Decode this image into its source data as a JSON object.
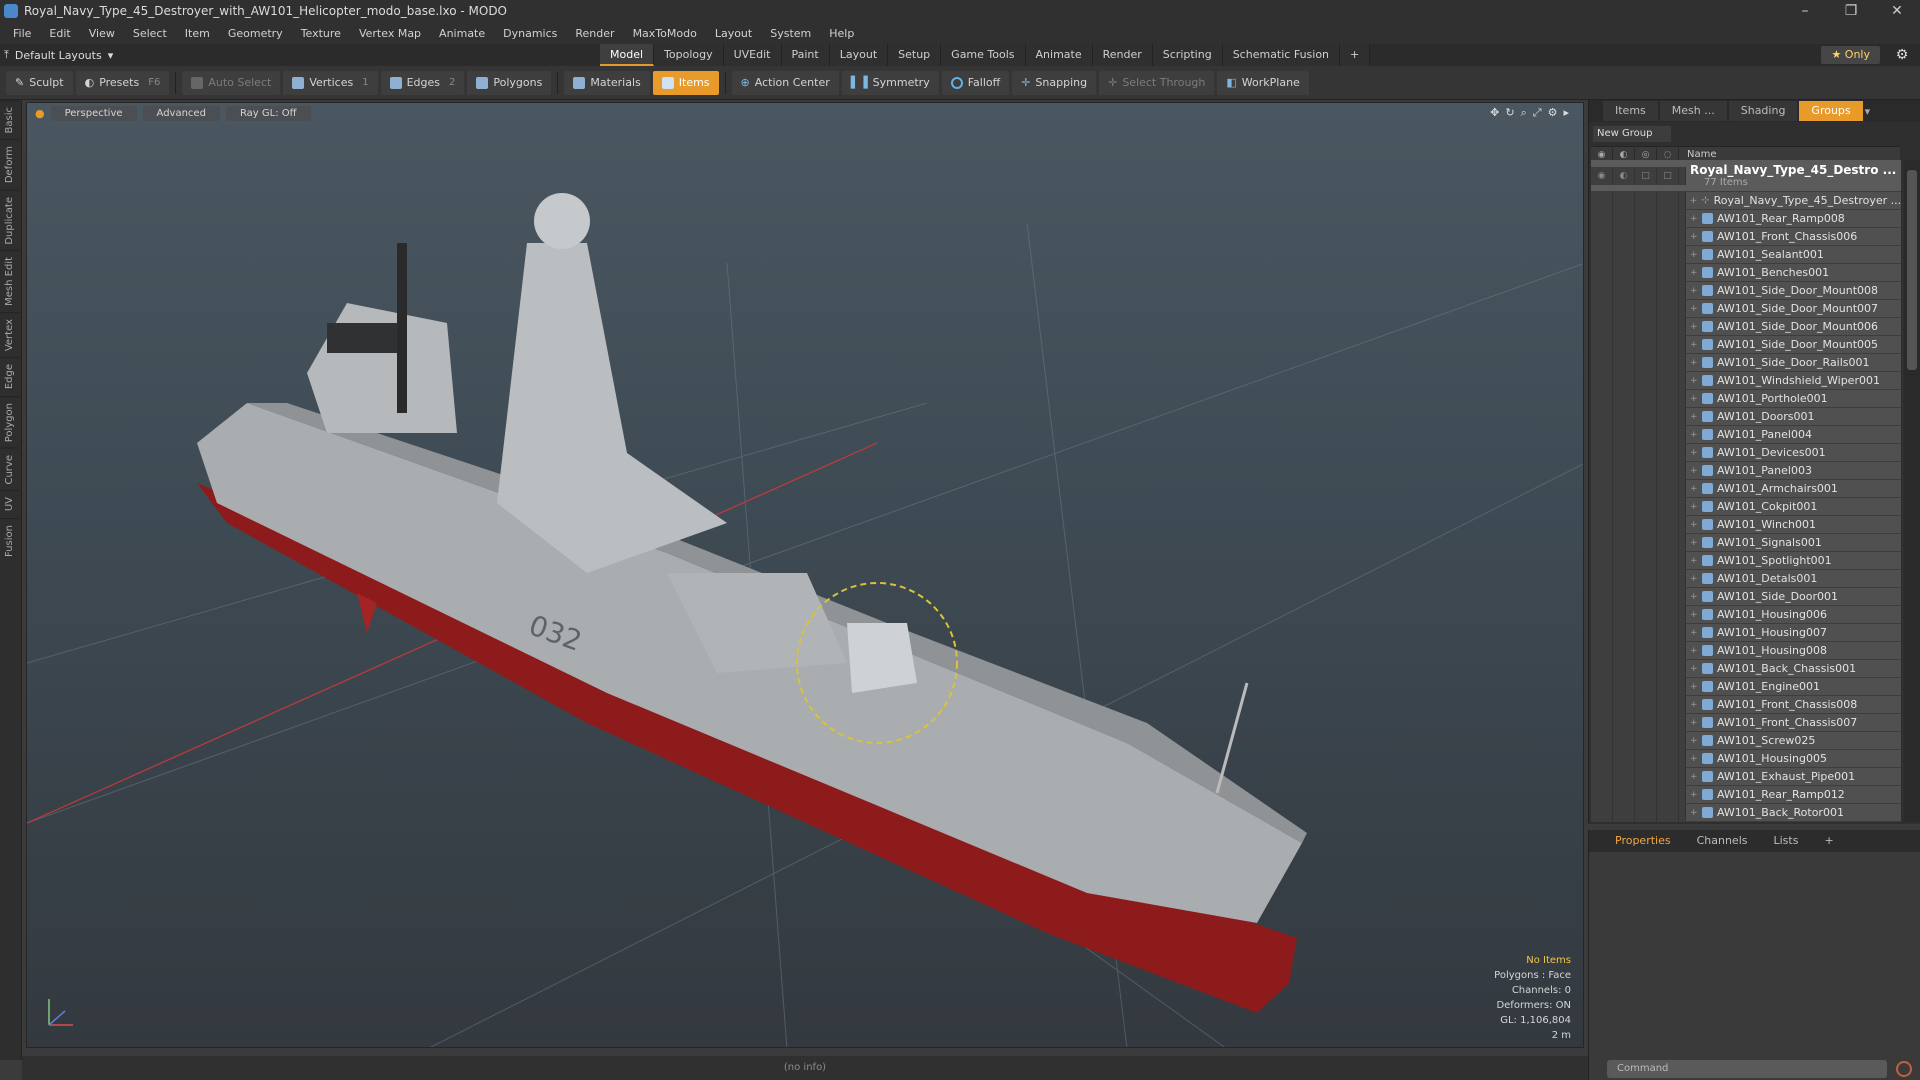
{
  "window": {
    "title": "Royal_Navy_Type_45_Destroyer_with_AW101_Helicopter_modo_base.lxo - MODO",
    "minimize": "–",
    "maximize": "❐",
    "close": "✕"
  },
  "menu": [
    "File",
    "Edit",
    "View",
    "Select",
    "Item",
    "Geometry",
    "Texture",
    "Vertex Map",
    "Animate",
    "Dynamics",
    "Render",
    "MaxToModo",
    "Layout",
    "System",
    "Help"
  ],
  "layout": {
    "default_label": "Default Layouts",
    "tabs": [
      "Model",
      "Topology",
      "UVEdit",
      "Paint",
      "Layout",
      "Setup",
      "Game Tools",
      "Animate",
      "Render",
      "Scripting",
      "Schematic Fusion"
    ],
    "active_tab": "Model",
    "add": "+",
    "only": "★  Only"
  },
  "toolbar": {
    "sculpt": "Sculpt",
    "presets": "Presets",
    "presets_key": "F6",
    "auto_select": "Auto Select",
    "vertices": "Vertices",
    "vertices_key": "1",
    "edges": "Edges",
    "edges_key": "2",
    "polygons": "Polygons",
    "materials": "Materials",
    "items": "Items",
    "action_center": "Action Center",
    "symmetry": "Symmetry",
    "falloff": "Falloff",
    "snapping": "Snapping",
    "select_through": "Select Through",
    "workplane": "WorkPlane"
  },
  "left_strip": [
    "Basic",
    "Deform",
    "Duplicate",
    "Mesh Edit",
    "Vertex",
    "Edge",
    "Polygon",
    "Curve",
    "UV",
    "Fusion"
  ],
  "viewport": {
    "perspective": "Perspective",
    "advanced": "Advanced",
    "raygl": "Ray GL: Off",
    "hull_number": "032",
    "stats": {
      "no_items": "No Items",
      "polygons": "Polygons : Face",
      "channels": "Channels: 0",
      "deformers": "Deformers: ON",
      "gl": "GL: 1,106,804",
      "scale": "2 m"
    }
  },
  "status": "(no info)",
  "panel_tabs": [
    "Items",
    "Mesh ...",
    "Shading",
    "Groups"
  ],
  "groups": {
    "new_group": "New Group",
    "name_header": "Name",
    "root": {
      "name": "Royal_Navy_Type_45_Destro ...",
      "count": "77 Items"
    },
    "items": [
      "Royal_Navy_Type_45_Destroyer ...",
      "AW101_Rear_Ramp008",
      "AW101_Front_Chassis006",
      "AW101_Sealant001",
      "AW101_Benches001",
      "AW101_Side_Door_Mount008",
      "AW101_Side_Door_Mount007",
      "AW101_Side_Door_Mount006",
      "AW101_Side_Door_Mount005",
      "AW101_Side_Door_Rails001",
      "AW101_Windshield_Wiper001",
      "AW101_Porthole001",
      "AW101_Doors001",
      "AW101_Panel004",
      "AW101_Devices001",
      "AW101_Panel003",
      "AW101_Armchairs001",
      "AW101_Cokpit001",
      "AW101_Winch001",
      "AW101_Signals001",
      "AW101_Spotlight001",
      "AW101_Detals001",
      "AW101_Side_Door001",
      "AW101_Housing006",
      "AW101_Housing007",
      "AW101_Housing008",
      "AW101_Back_Chassis001",
      "AW101_Engine001",
      "AW101_Front_Chassis008",
      "AW101_Front_Chassis007",
      "AW101_Screw025",
      "AW101_Housing005",
      "AW101_Exhaust_Pipe001",
      "AW101_Rear_Ramp012",
      "AW101_Back_Rotor001"
    ]
  },
  "properties": {
    "tabs": [
      "Properties",
      "Channels",
      "Lists"
    ],
    "add": "+",
    "command_placeholder": "Command"
  },
  "colors": {
    "accent": "#e89a2a",
    "hull": "#a8acaf",
    "red": "#9e1f1f"
  }
}
